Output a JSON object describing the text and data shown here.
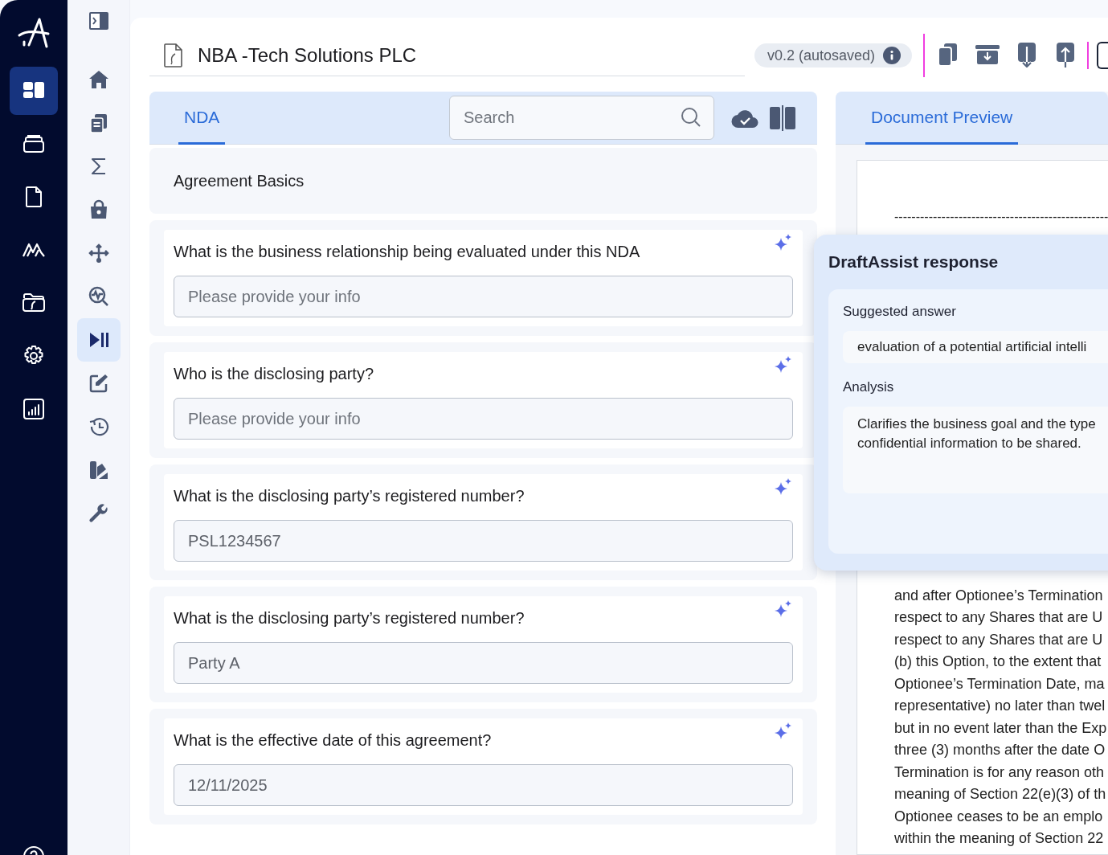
{
  "app_rail": {
    "items": [
      {
        "selected": true
      },
      {
        "selected": false
      },
      {
        "selected": false
      },
      {
        "selected": false
      },
      {
        "selected": false
      },
      {
        "selected": false
      },
      {
        "selected": false
      }
    ]
  },
  "tool_rail": {
    "items": [
      {
        "selected": false
      },
      {
        "selected": false
      },
      {
        "selected": false
      },
      {
        "selected": false
      },
      {
        "selected": false
      },
      {
        "selected": false
      },
      {
        "selected": false
      },
      {
        "selected": true
      },
      {
        "selected": false
      },
      {
        "selected": false
      },
      {
        "selected": false
      },
      {
        "selected": false
      }
    ]
  },
  "header": {
    "title": "NBA -Tech Solutions PLC",
    "version": "v0.2 (autosaved)"
  },
  "form": {
    "tabs": [
      {
        "label": "NDA",
        "selected": true
      }
    ],
    "search": {
      "placeholder": "Search"
    },
    "section_title": "Agreement Basics",
    "questions": [
      {
        "question": "What is the business relationship being evaluated under this NDA",
        "placeholder": "Please provide your info"
      },
      {
        "question": "Who is the disclosing party?",
        "placeholder": "Please provide your info"
      },
      {
        "question": "What is the disclosing party’s registered number?",
        "value": "PSL1234567"
      },
      {
        "question": "What is the disclosing party’s registered number?",
        "value": "Party A"
      },
      {
        "question": "What is the effective date of this agreement?",
        "value": "12/11/2025"
      }
    ]
  },
  "preview": {
    "tabs": [
      {
        "label": "Document Preview",
        "selected": true
      }
    ],
    "separator": "--------------------------------------------------",
    "lines": [
      "and after Optionee’s Termination",
      "respect to any Shares that are U",
      "respect to any Shares that are U",
      "(b) this Option, to the extent that",
      "Optionee’s Termination Date, ma",
      "representative) no later than twel",
      "but in no event later than the Exp",
      "three (3) months after the date O",
      "Termination is for any reason oth",
      "meaning of Section 22(e)(3) of th",
      "Optionee ceases to be an emplo",
      "within the meaning of Section 22"
    ]
  },
  "assist": {
    "title": "DraftAssist response",
    "suggested_label": "Suggested answer",
    "suggested": "evaluation of a potential artificial intelli",
    "analysis_label": "Analysis",
    "analysis": [
      "Clarifies the business goal and the type",
      "confidential information to be shared."
    ]
  }
}
